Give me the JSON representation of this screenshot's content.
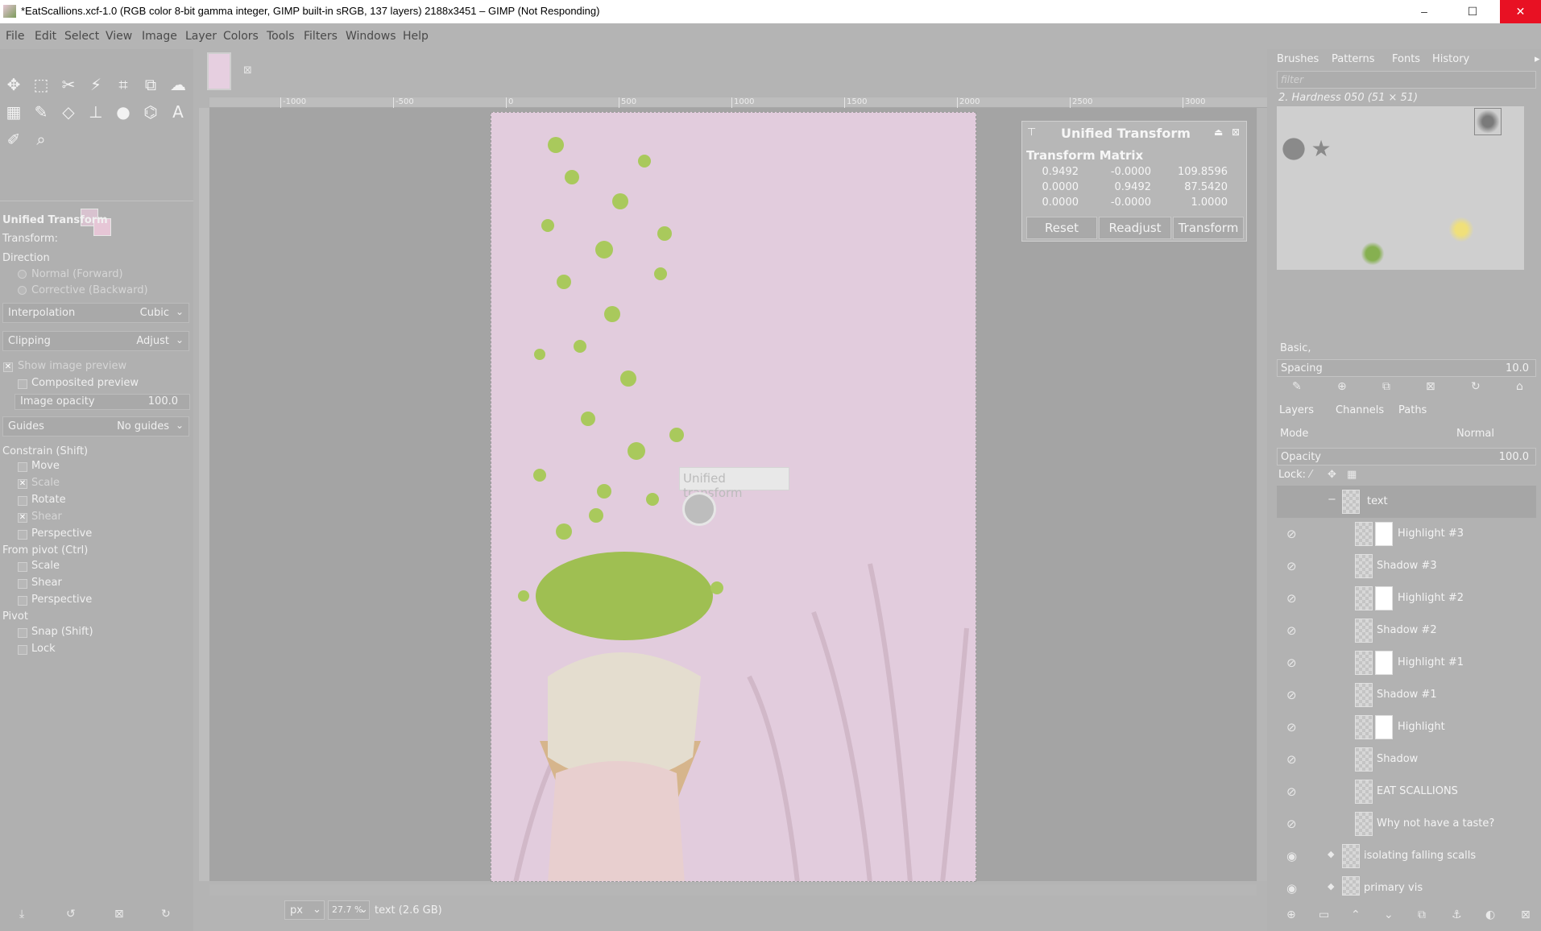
{
  "window": {
    "title": "*EatScallions.xcf-1.0 (RGB color 8-bit gamma integer, GIMP built-in sRGB, 137 layers) 2188x3451 – GIMP (Not Responding)",
    "minimize": "–",
    "maximize": "☐",
    "close": "✕"
  },
  "menu": [
    "File",
    "Edit",
    "Select",
    "View",
    "Image",
    "Layer",
    "Colors",
    "Tools",
    "Filters",
    "Windows",
    "Help"
  ],
  "tool_options": {
    "title": "Unified Transform",
    "transform_label": "Transform:",
    "direction_label": "Direction",
    "direction_normal": "Normal (Forward)",
    "direction_corrective": "Corrective (Backward)",
    "interpolation_label": "Interpolation",
    "interpolation_value": "Cubic",
    "clipping_label": "Clipping",
    "clipping_value": "Adjust",
    "show_preview": "Show image preview",
    "composited_preview": "Composited preview",
    "image_opacity_label": "Image opacity",
    "image_opacity_value": "100.0",
    "guides_label": "Guides",
    "guides_value": "No guides",
    "constrain_label": "Constrain (Shift)",
    "constrain_move": "Move",
    "constrain_scale": "Scale",
    "constrain_rotate": "Rotate",
    "constrain_shear": "Shear",
    "constrain_perspective": "Perspective",
    "frompivot_label": "From pivot  (Ctrl)",
    "frompivot_scale": "Scale",
    "frompivot_shear": "Shear",
    "frompivot_perspective": "Perspective",
    "pivot_label": "Pivot",
    "pivot_snap": "Snap (Shift)",
    "pivot_lock": "Lock"
  },
  "rulers": {
    "h_ticks": [
      "-1000",
      "-500",
      "0",
      "500",
      "1000",
      "1500",
      "2000",
      "2500",
      "3000"
    ]
  },
  "transform_dialog": {
    "title": "Unified Transform",
    "subtitle": "Transform Matrix",
    "matrix": [
      [
        "0.9492",
        "-0.0000",
        "109.8596"
      ],
      [
        "0.0000",
        "0.9492",
        "87.5420"
      ],
      [
        "0.0000",
        "-0.0000",
        "1.0000"
      ]
    ],
    "reset": "Reset",
    "readjust": "Readjust",
    "transform": "Transform"
  },
  "tooltip": "Unified transform",
  "status": {
    "unit": "px",
    "zoom": "27.7 %",
    "info": "text (2.6 GB)"
  },
  "brushes_panel": {
    "tabs": [
      "Brushes",
      "Patterns",
      "Fonts",
      "History"
    ],
    "filter_placeholder": "filter",
    "selected_brush": "2. Hardness 050 (51 × 51)",
    "preset": "Basic,",
    "spacing_label": "Spacing",
    "spacing_value": "10.0"
  },
  "layers_panel": {
    "tabs": [
      "Layers",
      "Channels",
      "Paths"
    ],
    "mode_label": "Mode",
    "mode_value": "Normal",
    "opacity_label": "Opacity",
    "opacity_value": "100.0",
    "lock_label": "Lock:",
    "layers": [
      {
        "name": "text",
        "group": true
      },
      {
        "name": "Highlight #3",
        "mask": true
      },
      {
        "name": "Shadow #3",
        "mask": false
      },
      {
        "name": "Highlight #2",
        "mask": true
      },
      {
        "name": "Shadow #2",
        "mask": false
      },
      {
        "name": "Highlight #1",
        "mask": true
      },
      {
        "name": "Shadow #1",
        "mask": false
      },
      {
        "name": "Highlight",
        "mask": true
      },
      {
        "name": "Shadow",
        "mask": false
      },
      {
        "name": "EAT SCALLIONS",
        "mask": false
      },
      {
        "name": "Why not have a taste?",
        "mask": false
      },
      {
        "name": "isolating falling scalls",
        "mask": false
      },
      {
        "name": "primary vis",
        "mask": false
      }
    ]
  },
  "colors": {
    "artboard": "#e2ccdd",
    "scallion": "#a8c85a",
    "close_red": "#e81123"
  }
}
